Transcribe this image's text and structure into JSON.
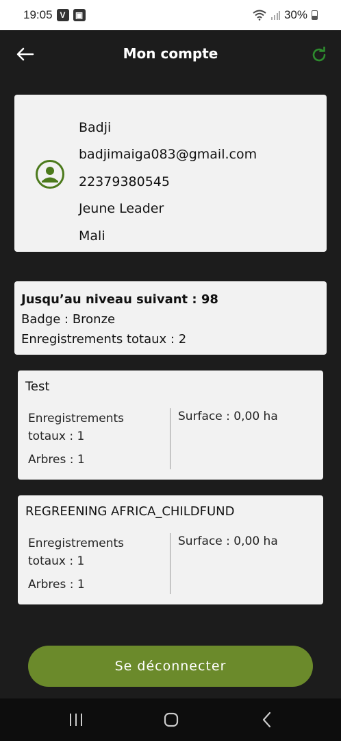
{
  "status_bar": {
    "time": "19:05",
    "battery": "30%"
  },
  "header": {
    "title": "Mon compte"
  },
  "profile": {
    "name": "Badji",
    "email": "badjimaiga083@gmail.com",
    "phone": "22379380545",
    "role": "Jeune Leader",
    "country": "Mali"
  },
  "level": {
    "next_level": "Jusqu’au niveau suivant : 98",
    "badge": "Badge : Bronze",
    "total_records": "Enregistrements totaux : 2"
  },
  "projects": [
    {
      "title": "Test",
      "records": "Enregistrements totaux : 1",
      "trees": "Arbres : 1",
      "surface": "Surface : 0,00 ha"
    },
    {
      "title": "REGREENING AFRICA_CHILDFUND",
      "records": "Enregistrements totaux : 1",
      "trees": "Arbres : 1",
      "surface": "Surface : 0,00 ha"
    }
  ],
  "logout_label": "Se déconnecter",
  "colors": {
    "accent": "#6b8a2b",
    "background": "#1c1c1c",
    "card": "#f2f2f2",
    "refresh": "#2e8b2e"
  },
  "icons": [
    "back-arrow-icon",
    "refresh-icon",
    "user-avatar-icon",
    "recents-icon",
    "home-icon",
    "nav-back-icon"
  ]
}
